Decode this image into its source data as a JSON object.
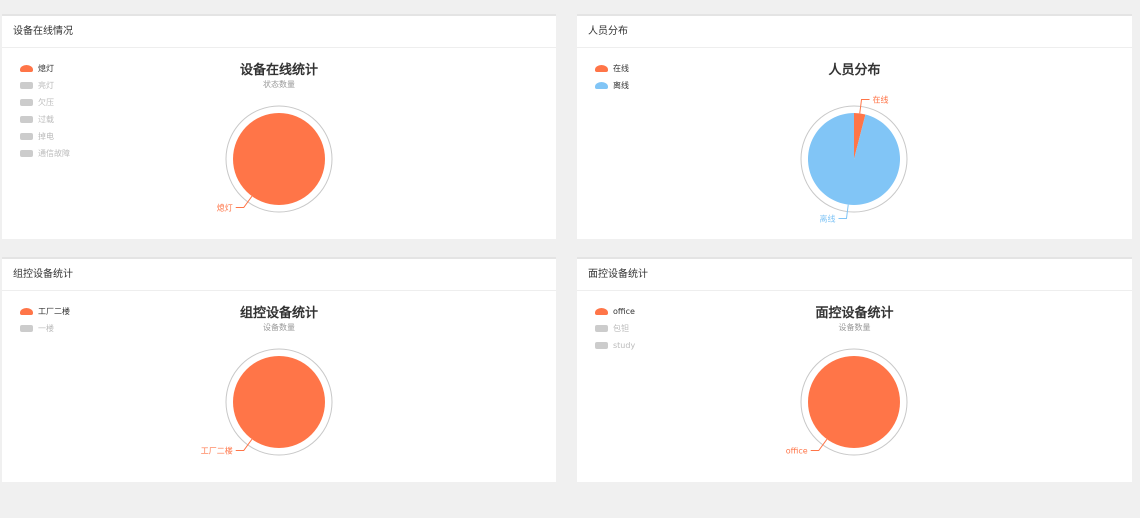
{
  "colors": {
    "accent": "#ff7548",
    "secondary": "#81c5f6",
    "inactive": "#cccccc"
  },
  "panels": [
    {
      "header": "设备在线情况",
      "chart_title": "设备在线统计",
      "chart_subtitle": "状态数量",
      "legend": [
        {
          "label": "熄灯",
          "active": true
        },
        {
          "label": "亮灯",
          "active": false
        },
        {
          "label": "欠压",
          "active": false
        },
        {
          "label": "过载",
          "active": false
        },
        {
          "label": "掉电",
          "active": false
        },
        {
          "label": "通信故障",
          "active": false
        }
      ]
    },
    {
      "header": "人员分布",
      "chart_title": "人员分布",
      "chart_subtitle": "",
      "legend": [
        {
          "label": "在线",
          "active": true
        },
        {
          "label": "离线",
          "active": true
        }
      ]
    },
    {
      "header": "组控设备统计",
      "chart_title": "组控设备统计",
      "chart_subtitle": "设备数量",
      "legend": [
        {
          "label": "工厂二楼",
          "active": true
        },
        {
          "label": "一楼",
          "active": false
        }
      ]
    },
    {
      "header": "面控设备统计",
      "chart_title": "面控设备统计",
      "chart_subtitle": "设备数量",
      "legend": [
        {
          "label": "office",
          "active": true
        },
        {
          "label": "包钽",
          "active": false
        },
        {
          "label": "study",
          "active": false
        }
      ]
    }
  ],
  "chart_data": [
    {
      "type": "pie",
      "title": "设备在线统计",
      "subtitle": "状态数量",
      "categories": [
        "熄灯"
      ],
      "values": [
        1
      ]
    },
    {
      "type": "pie",
      "title": "人员分布",
      "categories": [
        "在线",
        "离线"
      ],
      "values": [
        2,
        48
      ]
    },
    {
      "type": "pie",
      "title": "组控设备统计",
      "subtitle": "设备数量",
      "categories": [
        "工厂二楼"
      ],
      "values": [
        1
      ]
    },
    {
      "type": "pie",
      "title": "面控设备统计",
      "subtitle": "设备数量",
      "categories": [
        "office"
      ],
      "values": [
        1
      ]
    }
  ]
}
